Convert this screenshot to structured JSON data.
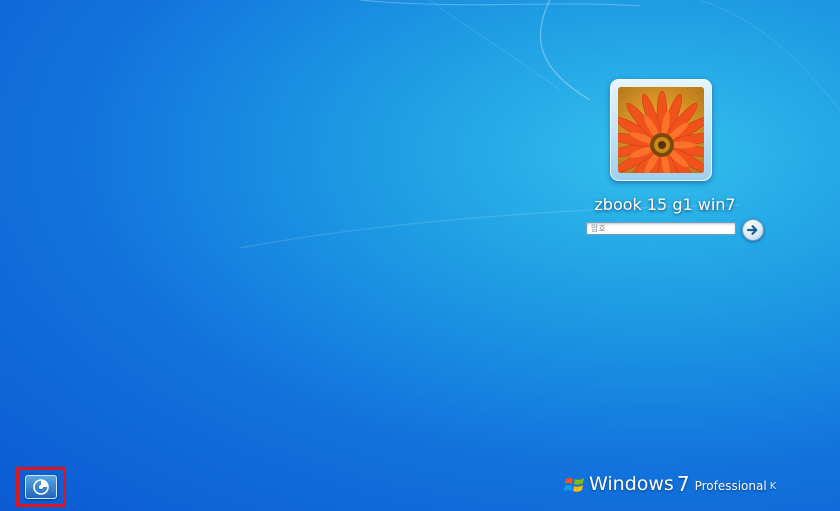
{
  "user": {
    "name": "zbook 15 g1 win7"
  },
  "password": {
    "placeholder": "암호",
    "value": ""
  },
  "branding": {
    "word": "Windows",
    "version": "7",
    "edition": "Professional",
    "mark": "K"
  },
  "icons": {
    "ease_of_access": "ease-of-access-icon",
    "submit": "arrow-right-icon",
    "logo": "windows-logo-icon"
  },
  "colors": {
    "background": "#1486e0",
    "highlight_box": "#e0151b"
  }
}
